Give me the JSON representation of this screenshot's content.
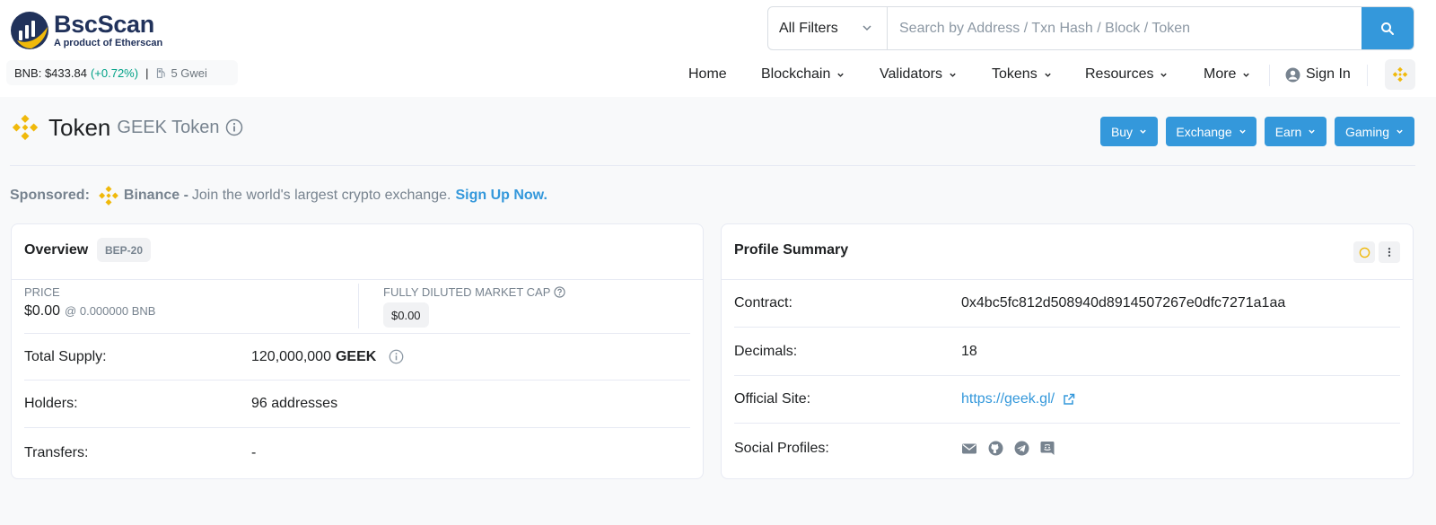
{
  "brand": {
    "name": "BscScan",
    "tagline": "A product of Etherscan"
  },
  "ticker": {
    "price": "BNB: $433.84",
    "change": "(+0.72%)",
    "separator": "|",
    "gas": "5 Gwei"
  },
  "search": {
    "filter": "All Filters",
    "placeholder": "Search by Address / Txn Hash / Block / Token"
  },
  "nav": {
    "home": "Home",
    "blockchain": "Blockchain",
    "validators": "Validators",
    "tokens": "Tokens",
    "resources": "Resources",
    "more": "More",
    "sign_in": "Sign In"
  },
  "title": {
    "main": "Token",
    "sub": "GEEK Token"
  },
  "actions": {
    "buy": "Buy",
    "exchange": "Exchange",
    "earn": "Earn",
    "gaming": "Gaming"
  },
  "sponsored": {
    "label": "Sponsored:",
    "brand": "Binance -",
    "text": "Join the world's largest crypto exchange.",
    "cta": "Sign Up Now."
  },
  "overview": {
    "title": "Overview",
    "badge": "BEP-20",
    "price_label": "PRICE",
    "price_value": "$0.00",
    "price_bnb": "@ 0.000000 BNB",
    "mcap_label": "FULLY DILUTED MARKET CAP",
    "mcap_value": "$0.00",
    "supply_label": "Total Supply:",
    "supply_value": "120,000,000",
    "supply_unit": "GEEK",
    "holders_label": "Holders:",
    "holders_value": "96 addresses",
    "transfers_label": "Transfers:",
    "transfers_value": "-"
  },
  "profile": {
    "title": "Profile Summary",
    "contract_label": "Contract:",
    "contract_value": "0x4bc5fc812d508940d8914507267e0dfc7271a1aa",
    "decimals_label": "Decimals:",
    "decimals_value": "18",
    "site_label": "Official Site:",
    "site_value": "https://geek.gl/",
    "social_label": "Social Profiles:",
    "social_icons": [
      "email-icon",
      "github-icon",
      "telegram-icon",
      "discord-icon"
    ]
  },
  "colors": {
    "primary": "#3498db",
    "brand_dark": "#21325b",
    "bnb_yellow": "#f0b90b",
    "positive": "#00a186"
  }
}
